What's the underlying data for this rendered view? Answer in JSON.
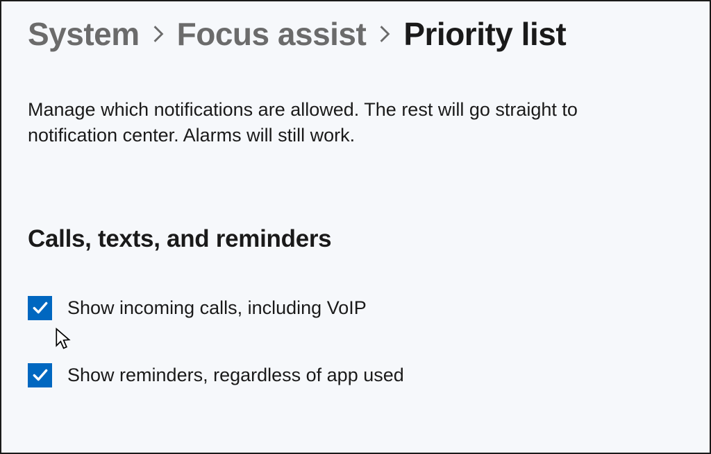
{
  "breadcrumb": {
    "items": [
      {
        "label": "System"
      },
      {
        "label": "Focus assist"
      }
    ],
    "current": "Priority list"
  },
  "description": "Manage which notifications are allowed. The rest will go straight to notification center. Alarms will still work.",
  "section": {
    "heading": "Calls, texts, and reminders",
    "options": [
      {
        "label": "Show incoming calls, including VoIP",
        "checked": true
      },
      {
        "label": "Show reminders, regardless of app used",
        "checked": true
      }
    ]
  },
  "colors": {
    "accent": "#0067c0",
    "text": "#1a1a1a",
    "muted": "#6b6b6b",
    "background": "#f6f8fb"
  }
}
